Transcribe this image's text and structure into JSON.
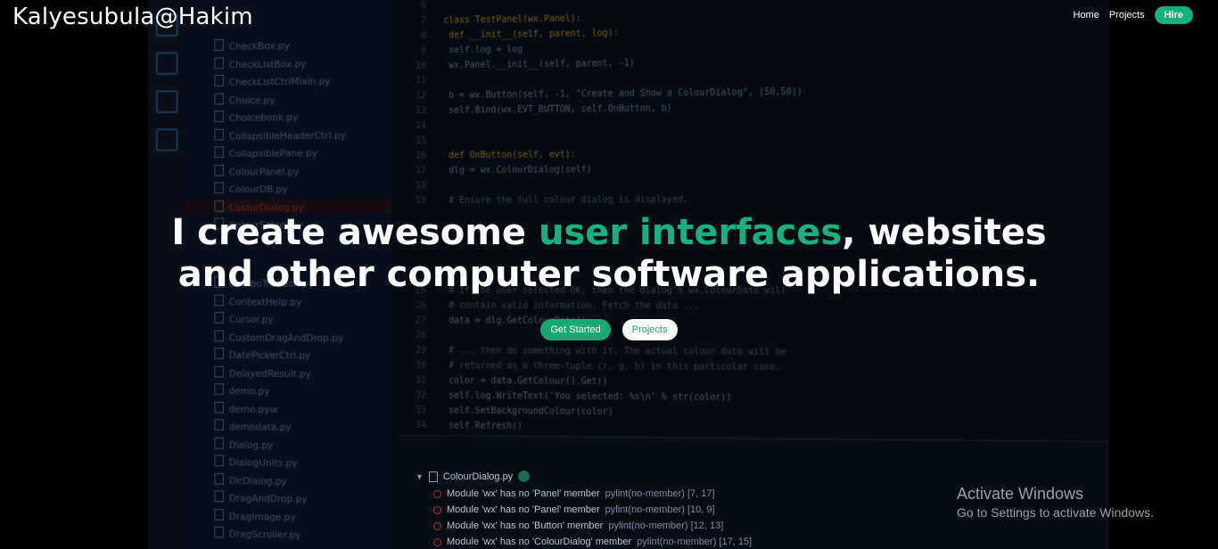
{
  "brand": {
    "name": "Kalyesubula@Hakim"
  },
  "nav": {
    "home": "Home",
    "projects": "Projects",
    "hire": "Hire"
  },
  "hero": {
    "part1": "I create awesome ",
    "highlight": "user interfaces",
    "part2": ", websites",
    "line2": "and other computer software applications."
  },
  "cta": {
    "primary": "Get Started",
    "secondary": "Projects"
  },
  "colors": {
    "accent": "#16b07b",
    "background": "#000000",
    "text": "#ffffff"
  },
  "background_editor": {
    "files": [
      "CheckBox.py",
      "CheckListBox.py",
      "CheckListCtrlMixin.py",
      "Choice.py",
      "Choicebook.py",
      "CollapsibleHeaderCtrl.py",
      "CollapsiblePane.py",
      "ColourPanel.py",
      "ColourDB.py",
      "ColourDialog.py",
      "ColourSelect.py"
    ],
    "selected_file": "ColourDialog.py",
    "lower_files": [
      "ComboTreeBox.py",
      "ContextHelp.py",
      "Cursor.py",
      "CustomDragAndDrop.py",
      "DatePickerCtrl.py",
      "DelayedResult.py",
      "demo.py",
      "demo.pyw",
      "demodata.py",
      "Dialog.py",
      "DialogUnits.py",
      "DirDialog.py",
      "DragAndDrop.py",
      "DragImage.py",
      "DragScroller.py"
    ],
    "code_lines": [
      {
        "n": "6",
        "t": ""
      },
      {
        "n": "7",
        "t": "class TestPanel(wx.Panel):"
      },
      {
        "n": "8",
        "t": "    def __init__(self, parent, log):"
      },
      {
        "n": "9",
        "t": "        self.log = log"
      },
      {
        "n": "10",
        "t": "        wx.Panel.__init__(self, parent, -1)"
      },
      {
        "n": "11",
        "t": ""
      },
      {
        "n": "12",
        "t": "        b = wx.Button(self, -1, \"Create and Show a ColourDialog\", (50,50))"
      },
      {
        "n": "13",
        "t": "        self.Bind(wx.EVT_BUTTON, self.OnButton, b)"
      },
      {
        "n": "14",
        "t": ""
      },
      {
        "n": "15",
        "t": ""
      },
      {
        "n": "16",
        "t": "    def OnButton(self, evt):"
      },
      {
        "n": "17",
        "t": "        dlg = wx.ColourDialog(self)"
      },
      {
        "n": "18",
        "t": ""
      },
      {
        "n": "19",
        "t": "        # Ensure the full colour dialog is displayed,"
      },
      {
        "n": "25",
        "t": "        # If the user selected OK, then the dialog's wx.ColourData will"
      },
      {
        "n": "26",
        "t": "        # contain valid information. Fetch the data ..."
      },
      {
        "n": "27",
        "t": "        data = dlg.GetColourData()"
      },
      {
        "n": "28",
        "t": ""
      },
      {
        "n": "29",
        "t": "        # ... then do something with it. The actual colour data will be"
      },
      {
        "n": "30",
        "t": "        # returned as a three-tuple (r, g, b) in this particular case."
      },
      {
        "n": "31",
        "t": "        color = data.GetColour().Get()"
      },
      {
        "n": "32",
        "t": "        self.log.WriteText('You selected: %s\\n' % str(color))"
      },
      {
        "n": "33",
        "t": "        self.SetBackgroundColour(color)"
      },
      {
        "n": "34",
        "t": "        self.Refresh()"
      }
    ],
    "problems_file": "ColourDialog.py",
    "problems": [
      {
        "msg": "Module 'wx' has no 'Panel' member",
        "code": "pylint(no-member) [7, 17]"
      },
      {
        "msg": "Module 'wx' has no 'Panel' member",
        "code": "pylint(no-member) [10, 9]"
      },
      {
        "msg": "Module 'wx' has no 'Button' member",
        "code": "pylint(no-member) [12, 13]"
      },
      {
        "msg": "Module 'wx' has no 'ColourDialog' member",
        "code": "pylint(no-member) [17, 15]"
      }
    ]
  },
  "watermark": {
    "title": "Activate Windows",
    "subtitle": "Go to Settings to activate Windows."
  }
}
